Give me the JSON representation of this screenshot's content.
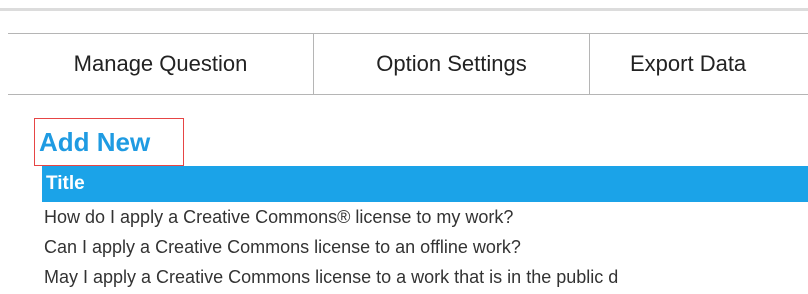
{
  "tabs": [
    {
      "label": "Manage Question"
    },
    {
      "label": "Option Settings"
    },
    {
      "label": "Export Data"
    }
  ],
  "actions": {
    "add_new_label": "Add New"
  },
  "table": {
    "header": "Title",
    "rows": [
      "How do I apply a Creative Commons® license to my work?",
      "Can I apply a Creative Commons license to an offline work?",
      "May I apply a Creative Commons license to a work that is in the public d"
    ]
  },
  "colors": {
    "accent": "#1ba3e8",
    "link": "#1f9be2",
    "highlight_border": "#e64545"
  }
}
